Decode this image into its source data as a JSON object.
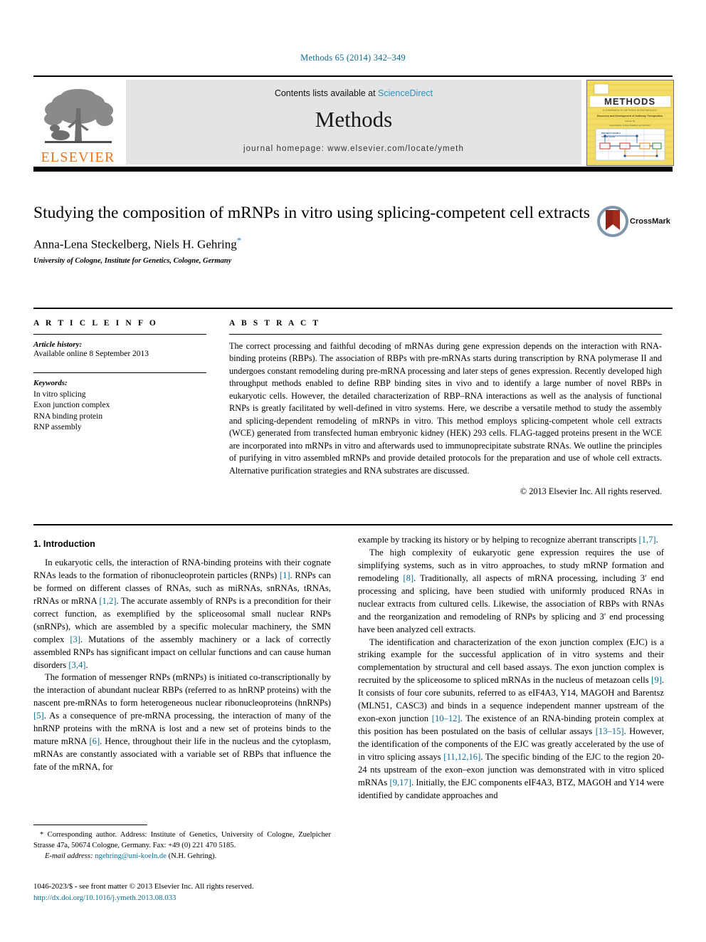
{
  "running_head": "Methods 65 (2014) 342–349",
  "masthead": {
    "publisher_name": "ELSEVIER",
    "contents_prefix": "Contents lists available at ",
    "contents_link": "ScienceDirect",
    "journal_title": "Methods",
    "homepage_line": "journal homepage: www.elsevier.com/locate/ymeth",
    "cover_title": "METHODS",
    "cover_sub1": "A Companion to Methods in Enzymology",
    "cover_sub2": "Discovery and Development of Antibody Therapeutics",
    "cover_sub3": "Volume 65",
    "cover_sub4": "Guest Editors: Andrew Bradbury and Jeff Allen",
    "cover_inset1": "PROJECT EXON 2",
    "cover_inset2": "TOTAL FLUX"
  },
  "article": {
    "title": "Studying the composition of mRNPs in vitro using splicing-competent cell extracts",
    "authors": "Anna-Lena Steckelberg, Niels H. Gehring",
    "corresponding_marker": "*",
    "affiliation": "University of Cologne, Institute for Genetics, Cologne, Germany",
    "crossmark_label": "CrossMark"
  },
  "article_info": {
    "heading": "A R T I C L E    I N F O",
    "history_label": "Article history:",
    "history_value": "Available online 8 September 2013",
    "keywords_label": "Keywords:",
    "keywords": [
      "In vitro splicing",
      "Exon junction complex",
      "RNA binding protein",
      "RNP assembly"
    ]
  },
  "abstract": {
    "heading": "A B S T R A C T",
    "text": "The correct processing and faithful decoding of mRNAs during gene expression depends on the interaction with RNA-binding proteins (RBPs). The association of RBPs with pre-mRNAs starts during transcription by RNA polymerase II and undergoes constant remodeling during pre-mRNA processing and later steps of genes expression. Recently developed high throughput methods enabled to define RBP binding sites in vivo and to identify a large number of novel RBPs in eukaryotic cells. However, the detailed characterization of RBP–RNA interactions as well as the analysis of functional RNPs is greatly facilitated by well-defined in vitro systems. Here, we describe a versatile method to study the assembly and splicing-dependent remodeling of mRNPs in vitro. This method employs splicing-competent whole cell extracts (WCE) generated from transfected human embryonic kidney (HEK) 293 cells. FLAG-tagged proteins present in the WCE are incorporated into mRNPs in vitro and afterwards used to immunoprecipitate substrate RNAs. We outline the principles of purifying in vitro assembled mRNPs and provide detailed protocols for the preparation and use of whole cell extracts. Alternative purification strategies and RNA substrates are discussed.",
    "copyright": "© 2013 Elsevier Inc. All rights reserved."
  },
  "introduction": {
    "section_number_title": "1. Introduction",
    "left_paragraphs": [
      "In eukaryotic cells, the interaction of RNA-binding proteins with their cognate RNAs leads to the formation of ribonucleoprotein particles (RNPs) [1]. RNPs can be formed on different classes of RNAs, such as miRNAs, snRNAs, tRNAs, rRNAs or mRNA [1,2]. The accurate assembly of RNPs is a precondition for their correct function, as exemplified by the spliceosomal small nuclear RNPs (snRNPs), which are assembled by a specific molecular machinery, the SMN complex [3]. Mutations of the assembly machinery or a lack of correctly assembled RNPs has significant impact on cellular functions and can cause human disorders [3,4].",
      "The formation of messenger RNPs (mRNPs) is initiated co-transcriptionally by the interaction of abundant nuclear RBPs (referred to as hnRNP proteins) with the nascent pre-mRNAs to form heterogeneous nuclear ribonucleoproteins (hnRNPs) [5]. As a consequence of pre-mRNA processing, the interaction of many of the hnRNP proteins with the mRNA is lost and a new set of proteins binds to the mature mRNA [6]. Hence, throughout their life in the nucleus and the cytoplasm, mRNAs are constantly associated with a variable set of RBPs that influence the fate of the mRNA, for"
    ],
    "right_paragraphs": [
      "example by tracking its history or by helping to recognize aberrant transcripts [1,7].",
      "The high complexity of eukaryotic gene expression requires the use of simplifying systems, such as in vitro approaches, to study mRNP formation and remodeling [8]. Traditionally, all aspects of mRNA processing, including 3′ end processing and splicing, have been studied with uniformly produced RNAs in nuclear extracts from cultured cells. Likewise, the association of RBPs with RNAs and the reorganization and remodeling of RNPs by splicing and 3′ end processing have been analyzed cell extracts.",
      "The identification and characterization of the exon junction complex (EJC) is a striking example for the successful application of in vitro systems and their complementation by structural and cell based assays. The exon junction complex is recruited by the spliceosome to spliced mRNAs in the nucleus of metazoan cells [9]. It consists of four core subunits, referred to as eIF4A3, Y14, MAGOH and Barentsz (MLN51, CASC3) and binds in a sequence independent manner upstream of the exon-exon junction [10–12]. The existence of an RNA-binding protein complex at this position has been postulated on the basis of cellular assays [13–15]. However, the identification of the components of the EJC was greatly accelerated by the use of in vitro splicing assays [11,12,16]. The specific binding of the EJC to the region 20-24 nts upstream of the exon–exon junction was demonstrated with in vitro spliced mRNAs [9,17]. Initially, the EJC components eIF4A3, BTZ, MAGOH and Y14 were identified by candidate approaches and"
    ]
  },
  "footnote": {
    "marker": "*",
    "text": "Corresponding author. Address: Institute of Genetics, University of Cologne, Zuelpicher Strasse 47a, 50674 Cologne, Germany. Fax: +49 (0) 221 470 5185.",
    "email_label": "E-mail address:",
    "email": "ngehring@uni-koeln.de",
    "email_suffix": "(N.H. Gehring)."
  },
  "bottom_matter": {
    "front_matter": "1046-2023/$ - see front matter © 2013 Elsevier Inc. All rights reserved.",
    "doi": "http://dx.doi.org/10.1016/j.ymeth.2013.08.033"
  },
  "colors": {
    "link": "#0b6d96",
    "science_direct": "#2e8fc0",
    "elsevier_orange": "#e87722",
    "cover_yellow": "#f2dc64"
  }
}
